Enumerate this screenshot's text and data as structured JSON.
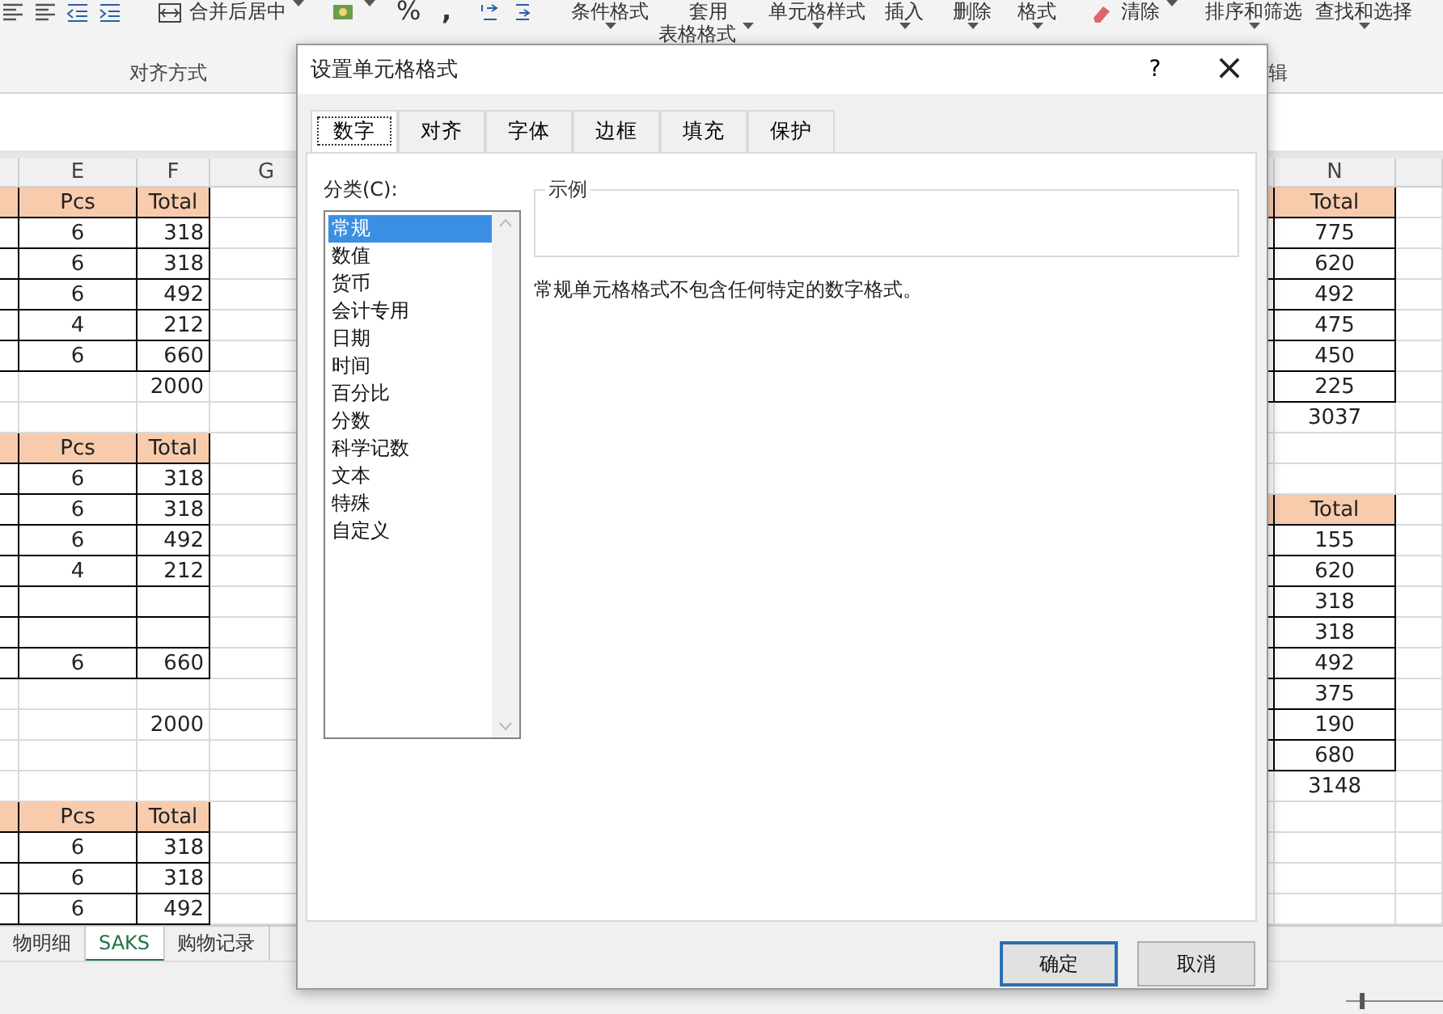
{
  "ribbon": {
    "merge_label": "合并后居中",
    "percent": "%",
    "comma": ",",
    "commands": [
      {
        "label": "条件格式"
      },
      {
        "label": "套用",
        "label2": "表格格式"
      },
      {
        "label": "单元格样式"
      },
      {
        "label": "插入"
      },
      {
        "label": "删除"
      },
      {
        "label": "格式"
      }
    ],
    "clear": "清除",
    "sort": "排序和筛选",
    "find": "查找和选择",
    "group_labels": [
      "对齐方式",
      "辑"
    ]
  },
  "sheet": {
    "left_columns": [
      "E",
      "F",
      "G"
    ],
    "right_columns": [
      "N"
    ],
    "left_rows": [
      {
        "kind": "header",
        "e": "Pcs",
        "f": "Total"
      },
      {
        "kind": "data",
        "e": "6",
        "f": "318"
      },
      {
        "kind": "data",
        "e": "6",
        "f": "318"
      },
      {
        "kind": "data",
        "e": "6",
        "f": "492"
      },
      {
        "kind": "data",
        "e": "4",
        "f": "212"
      },
      {
        "kind": "data",
        "e": "6",
        "f": "660"
      },
      {
        "kind": "plain",
        "f": "2000"
      },
      {
        "kind": "plain"
      },
      {
        "kind": "header",
        "e": "Pcs",
        "f": "Total"
      },
      {
        "kind": "data",
        "e": "6",
        "f": "318"
      },
      {
        "kind": "data",
        "e": "6",
        "f": "318"
      },
      {
        "kind": "data",
        "e": "6",
        "f": "492"
      },
      {
        "kind": "data",
        "e": "4",
        "f": "212"
      },
      {
        "kind": "data"
      },
      {
        "kind": "data"
      },
      {
        "kind": "data",
        "e": "6",
        "f": "660"
      },
      {
        "kind": "plain"
      },
      {
        "kind": "plain",
        "f": "2000"
      },
      {
        "kind": "plain"
      },
      {
        "kind": "plain"
      },
      {
        "kind": "header",
        "e": "Pcs",
        "f": "Total"
      },
      {
        "kind": "data",
        "e": "6",
        "f": "318"
      },
      {
        "kind": "data",
        "e": "6",
        "f": "318"
      },
      {
        "kind": "data",
        "e": "6",
        "f": "492"
      }
    ],
    "right_rows": [
      {
        "kind": "header",
        "n": "Total"
      },
      {
        "kind": "data",
        "n": "775"
      },
      {
        "kind": "data",
        "n": "620"
      },
      {
        "kind": "data",
        "n": "492"
      },
      {
        "kind": "data",
        "n": "475"
      },
      {
        "kind": "data",
        "n": "450"
      },
      {
        "kind": "data",
        "n": "225"
      },
      {
        "kind": "plain",
        "n": "3037"
      },
      {
        "kind": "plain"
      },
      {
        "kind": "plain"
      },
      {
        "kind": "header",
        "n": "Total"
      },
      {
        "kind": "data",
        "n": "155"
      },
      {
        "kind": "data",
        "n": "620"
      },
      {
        "kind": "data",
        "n": "318"
      },
      {
        "kind": "data",
        "n": "318"
      },
      {
        "kind": "data",
        "n": "492"
      },
      {
        "kind": "data",
        "n": "375"
      },
      {
        "kind": "data",
        "n": "190"
      },
      {
        "kind": "data",
        "n": "680"
      },
      {
        "kind": "plain",
        "n": "3148"
      },
      {
        "kind": "plain"
      },
      {
        "kind": "plain"
      },
      {
        "kind": "plain"
      },
      {
        "kind": "plain"
      }
    ]
  },
  "zoom": {
    "level": 0.15
  },
  "sheet_tabs": [
    {
      "label": "物明细",
      "selected": false
    },
    {
      "label": "SAKS",
      "selected": true
    },
    {
      "label": "购物记录",
      "selected": false
    }
  ],
  "dialog": {
    "title": "设置单元格格式",
    "help": "?",
    "close": "×",
    "tabs": [
      {
        "label": "数字",
        "selected": true
      },
      {
        "label": "对齐",
        "selected": false
      },
      {
        "label": "字体",
        "selected": false
      },
      {
        "label": "边框",
        "selected": false
      },
      {
        "label": "填充",
        "selected": false
      },
      {
        "label": "保护",
        "selected": false
      }
    ],
    "category_label": "分类(C):",
    "categories": [
      {
        "label": "常规",
        "selected": true
      },
      {
        "label": "数值",
        "selected": false
      },
      {
        "label": "货币",
        "selected": false
      },
      {
        "label": "会计专用",
        "selected": false
      },
      {
        "label": "日期",
        "selected": false
      },
      {
        "label": "时间",
        "selected": false
      },
      {
        "label": "百分比",
        "selected": false
      },
      {
        "label": "分数",
        "selected": false
      },
      {
        "label": "科学记数",
        "selected": false
      },
      {
        "label": "文本",
        "selected": false
      },
      {
        "label": "特殊",
        "selected": false
      },
      {
        "label": "自定义",
        "selected": false
      }
    ],
    "sample_label": "示例",
    "description": "常规单元格格式不包含任何特定的数字格式。",
    "buttons": [
      {
        "label": "确定",
        "kind": "default"
      },
      {
        "label": "取消",
        "kind": "normal"
      }
    ]
  }
}
